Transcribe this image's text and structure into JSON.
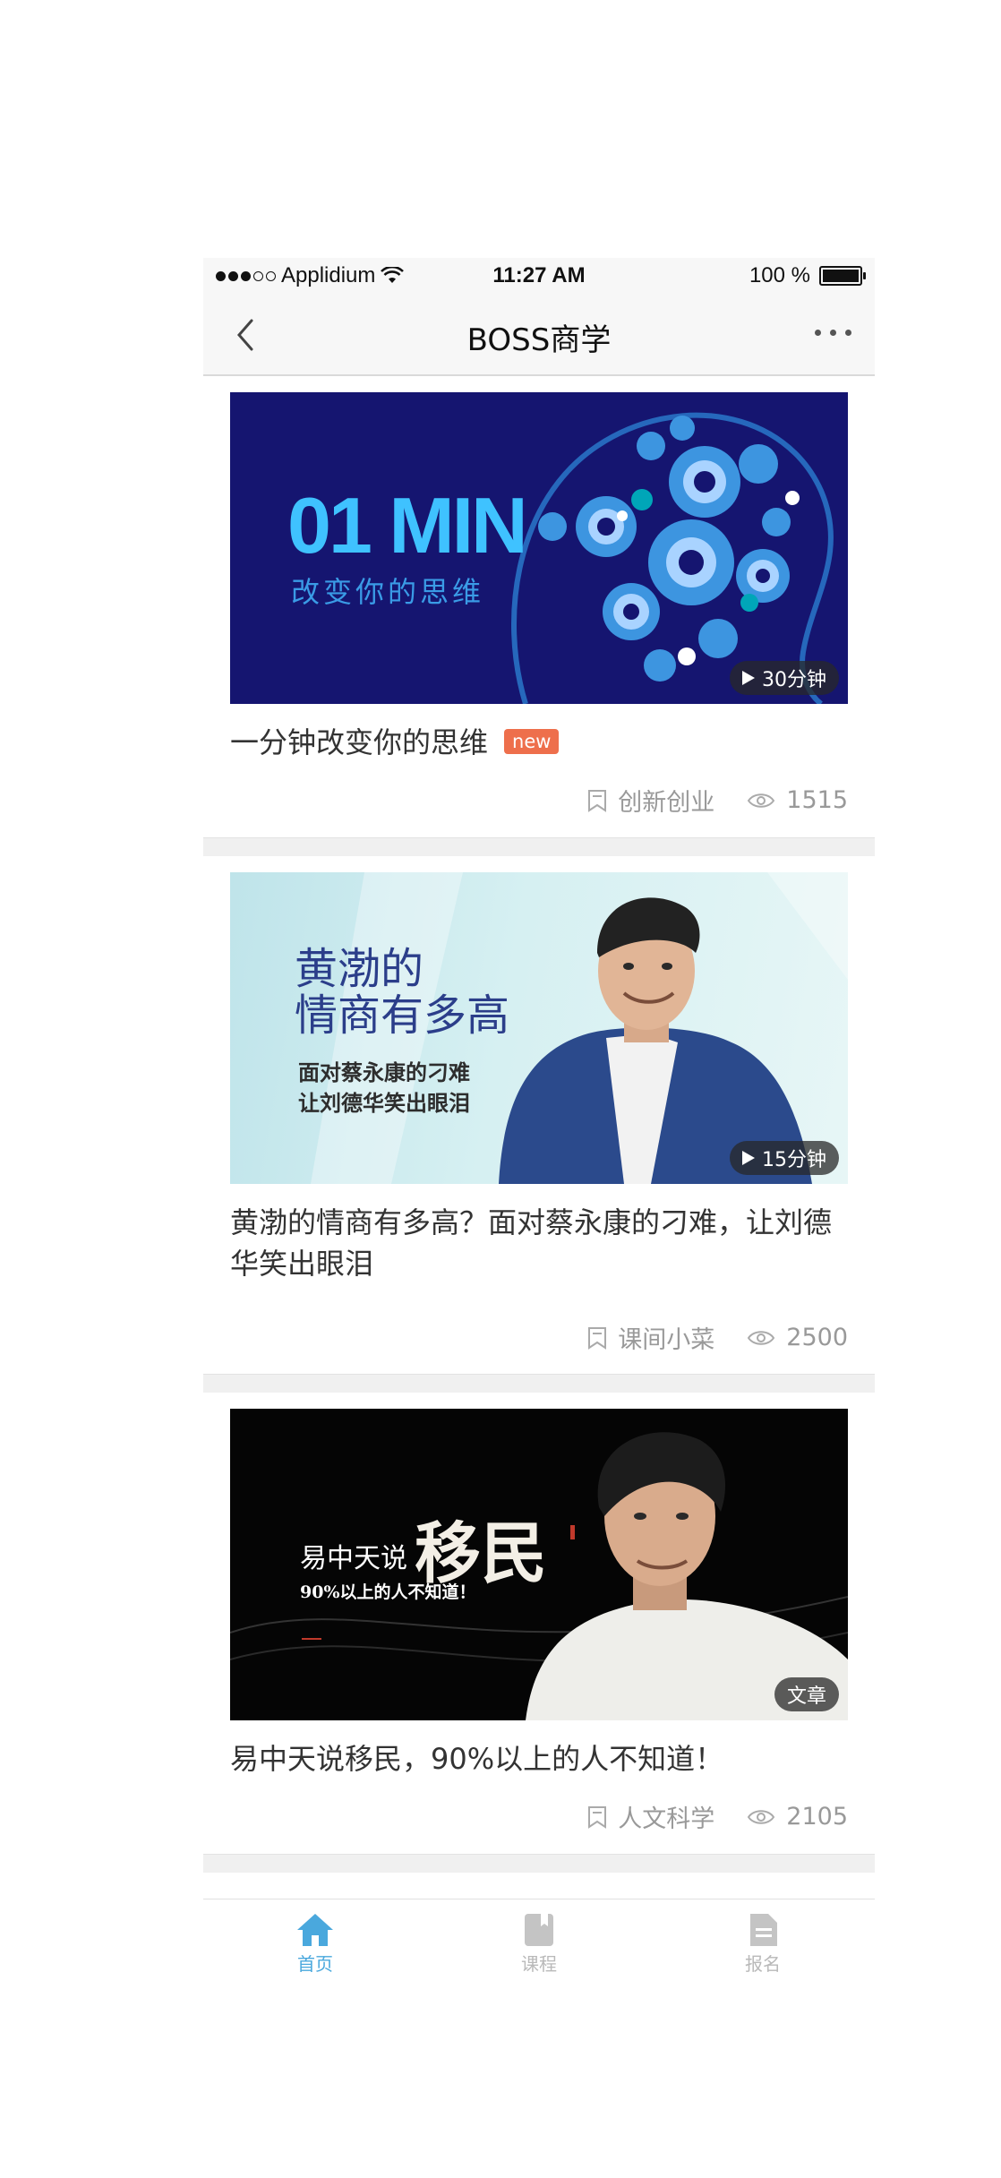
{
  "status_bar": {
    "carrier": "Applidium",
    "time": "11:27 AM",
    "battery": "100 %"
  },
  "nav": {
    "title": "BOSS商学"
  },
  "feed": [
    {
      "image_text": {
        "headline": "01 MIN",
        "sub": "改变你的思维"
      },
      "pill": "30分钟",
      "title": "一分钟改变你的思维",
      "badge": "new",
      "category": "创新创业",
      "views": "1515"
    },
    {
      "image_text": {
        "line1": "黄渤的",
        "line2": "情商有多高",
        "line3": "面对蔡永康的刁难",
        "line4": "让刘德华笑出眼泪"
      },
      "pill": "15分钟",
      "title": "黄渤的情商有多高？面对蔡永康的刁难，让刘德华笑出眼泪",
      "category": "课间小菜",
      "views": "2500"
    },
    {
      "image_text": {
        "line1": "易中天说",
        "big": "移民",
        "line2": "90%以上的人不知道！"
      },
      "pill": "文章",
      "title": "易中天说移民，90%以上的人不知道！",
      "category": "人文科学",
      "views": "2105"
    }
  ],
  "tabs": [
    {
      "label": "首页",
      "icon": "home-icon",
      "active": true
    },
    {
      "label": "课程",
      "icon": "book-icon",
      "active": false
    },
    {
      "label": "报名",
      "icon": "document-icon",
      "active": false
    }
  ],
  "colors": {
    "accent": "#4aa8dd",
    "badge": "#ee6f4c",
    "banner1": "#151570"
  }
}
